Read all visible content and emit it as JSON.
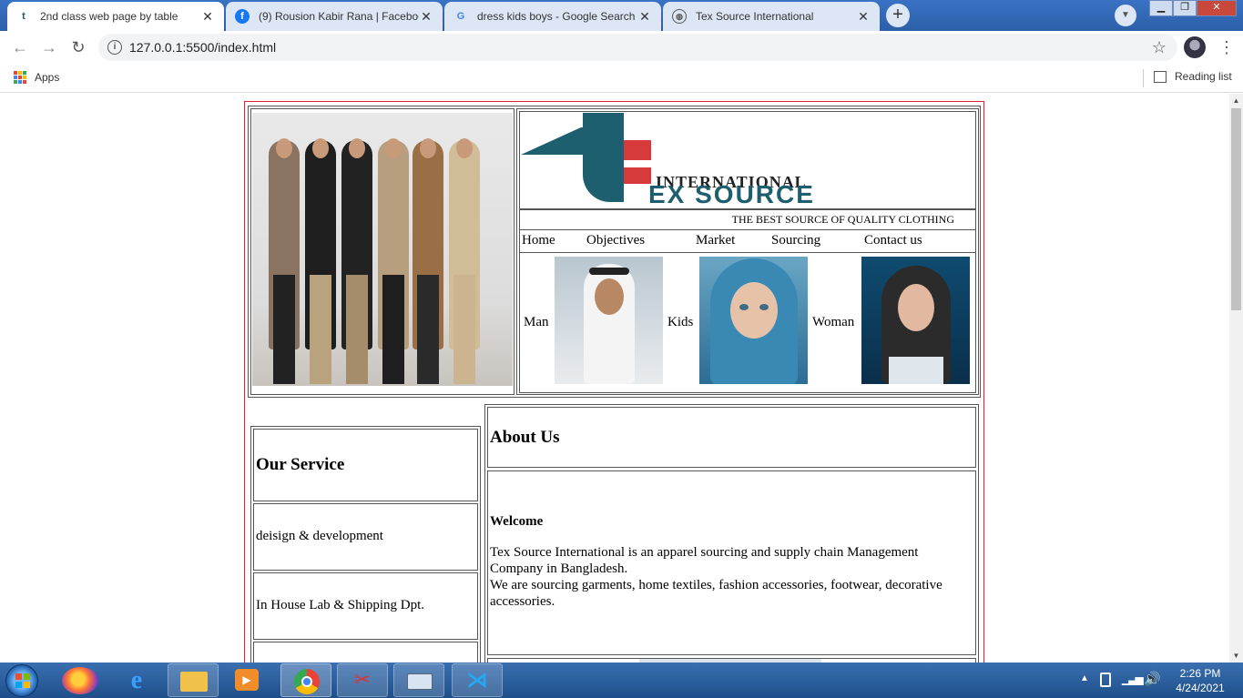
{
  "browser": {
    "tabs": [
      {
        "title": "2nd class web page by table",
        "favicon": "tex-logo-favicon",
        "active": true
      },
      {
        "title": "(9) Rousion Kabir Rana | Facebook",
        "favicon": "facebook-icon",
        "active": false
      },
      {
        "title": "dress kids boys - Google Search",
        "favicon": "google-icon",
        "active": false
      },
      {
        "title": "Tex Source International",
        "favicon": "globe-icon",
        "active": false
      }
    ],
    "url": "127.0.0.1:5500/index.html",
    "bookmarks": {
      "apps_label": "Apps",
      "reading_list_label": "Reading list"
    }
  },
  "page": {
    "logo": {
      "line1": "INTERNATIONAL",
      "line2": "EX SOURCE"
    },
    "tagline": "THE BEST SOURCE OF QUALITY CLOTHING",
    "nav": [
      "Home",
      "Objectives",
      "Market",
      "Sourcing",
      "Contact us"
    ],
    "categories": [
      "Man",
      "Kids",
      "Woman"
    ],
    "service": {
      "heading": "Our Service",
      "items": [
        "deisign & development",
        "In House Lab & Shipping Dpt."
      ]
    },
    "about": {
      "heading": "About Us",
      "welcome": "Welcome",
      "para1": "Tex Source International is an apparel sourcing and supply chain Management Company in Bangladesh.",
      "para2": "We are sourcing garments, home textiles, fashion accessories, footwear, decorative accessories."
    }
  },
  "taskbar": {
    "time": "2:26 PM",
    "date": "4/24/2021",
    "apps": [
      "firefox-icon",
      "internet-explorer-icon",
      "file-explorer-icon",
      "media-player-icon",
      "chrome-icon",
      "snipping-tool-icon",
      "keyboard-icon",
      "vscode-icon"
    ]
  },
  "colors": {
    "accent_red": "#dd2233",
    "logo_teal": "#1d5f6f",
    "logo_red": "#d63a3a",
    "taskbar": "#1e4f8a"
  }
}
